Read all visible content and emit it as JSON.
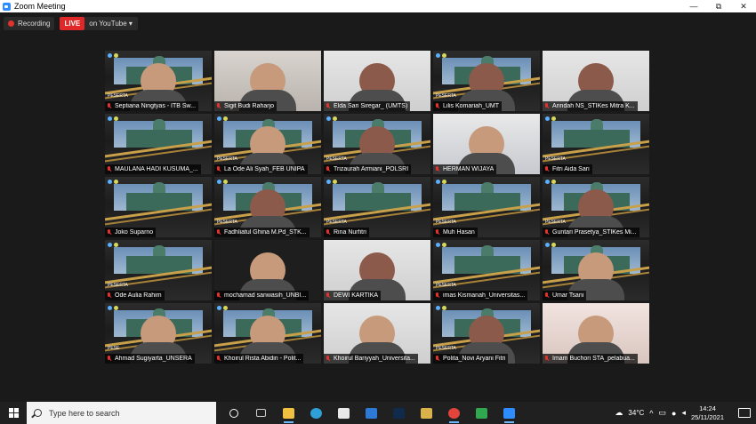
{
  "window": {
    "title": "Zoom Meeting",
    "minimize": "—",
    "maximize": "⧉",
    "close": "✕"
  },
  "controls": {
    "recording_label": "Recording",
    "live_badge": "LIVE",
    "live_target": "on YouTube",
    "live_caret": "▾"
  },
  "participants": [
    {
      "name": "Septiana Ningtyas - ITB Sw...",
      "bg": "banner",
      "peserta": "PESERTA",
      "person": true
    },
    {
      "name": "Sigit Budi Raharjo",
      "bg": "room",
      "person": true
    },
    {
      "name": "Elda Sari Siregar_ (UMTS)",
      "bg": "wall",
      "person": true,
      "hijab": true
    },
    {
      "name": "Lilis Komariah_UMT",
      "bg": "banner",
      "peserta": "PESERTA",
      "person": true,
      "hijab": true
    },
    {
      "name": "Arindah NS_STIKes Mitra K...",
      "bg": "wall",
      "person": true,
      "hijab": true
    },
    {
      "name": "MAULANA HADI KUSUMA_...",
      "bg": "banner",
      "peserta": "",
      "person": false
    },
    {
      "name": "La Ode Ali Syah_FEB UNIPA",
      "bg": "banner",
      "peserta": "PESERTA",
      "person": true
    },
    {
      "name": "Trizaurah Armiani_POLSRI",
      "bg": "banner",
      "peserta": "PESERTA",
      "person": true,
      "hijab": true
    },
    {
      "name": "HERMAN WIJAYA",
      "bg": "blue",
      "person": true
    },
    {
      "name": "Fitri Aida Sari",
      "bg": "banner",
      "peserta": "PESERTA",
      "person": false
    },
    {
      "name": "Joko Suparno",
      "bg": "banner",
      "peserta": "",
      "person": false
    },
    {
      "name": "Fadhliatul Ghina M.Pd_STK...",
      "bg": "banner",
      "peserta": "PESERTA",
      "person": true,
      "hijab": true
    },
    {
      "name": "Rina Nurfitri",
      "bg": "banner",
      "peserta": "PESERTA",
      "person": false
    },
    {
      "name": "Muh Hasan",
      "bg": "banner",
      "peserta": "PESERTA",
      "person": false
    },
    {
      "name": "Guntari Prasetya_STIKes Mi...",
      "bg": "banner",
      "peserta": "PESERTA",
      "person": true,
      "hijab": true
    },
    {
      "name": "Ode Aulia Rahim",
      "bg": "banner",
      "peserta": "PESERTA",
      "person": false
    },
    {
      "name": "mochamad sanwasih_UNBI...",
      "bg": "dark",
      "person": true
    },
    {
      "name": "DEWI KARTIKA",
      "bg": "wall",
      "person": true,
      "hijab": true
    },
    {
      "name": "imas Kismanah_Universitas...",
      "bg": "banner",
      "peserta": "PESERTA",
      "person": false
    },
    {
      "name": "Umar Tsani",
      "bg": "banner",
      "peserta": "",
      "person": true
    },
    {
      "name": "Ahmad Sugiyarta_UNSERA",
      "bg": "banner",
      "peserta": "PESE",
      "person": true
    },
    {
      "name": "Khoirul Rista Abidin - Polit...",
      "bg": "banner",
      "peserta": "",
      "person": true
    },
    {
      "name": "Khoirul Bariyyah_Universita...",
      "bg": "wall",
      "person": true
    },
    {
      "name": "Polita_Novi Aryani Fitri",
      "bg": "banner",
      "peserta": "PESERTA",
      "person": true,
      "hijab": true
    },
    {
      "name": "Imam Buchori STA_pelabua...",
      "bg": "bed",
      "person": true
    }
  ],
  "taskbar": {
    "search_placeholder": "Type here to search",
    "apps": [
      "task-view",
      "task-switch",
      "file-explorer",
      "edge",
      "store",
      "mail",
      "photoshop",
      "tool",
      "chrome",
      "drive",
      "zoom"
    ],
    "weather": "34°C",
    "time": "14:24",
    "date": "25/11/2021"
  },
  "colors": {
    "accent": "#2d8cff",
    "live": "#e02828",
    "taskbar": "#202020"
  }
}
